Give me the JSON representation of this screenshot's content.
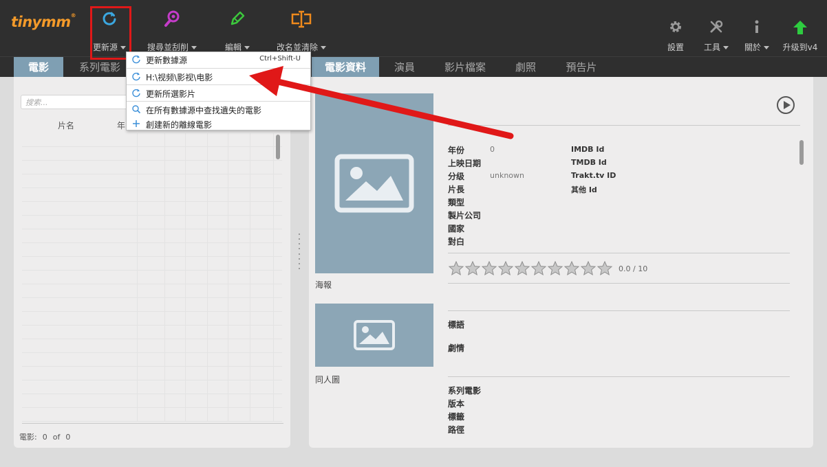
{
  "app": {
    "logo": "tinymm",
    "logo_mark": "®"
  },
  "toolbar": {
    "update_source": "更新源",
    "search_scrape": "搜尋並刮削",
    "edit": "編輯",
    "rename_clean": "改名並清除",
    "settings": "設置",
    "tools": "工具",
    "about": "關於",
    "upgrade": "升级到v4"
  },
  "left_tabs": {
    "movies": "電影",
    "series_movies": "系列電影"
  },
  "right_tabs": {
    "movie_info": "電影資料",
    "cast": "演員",
    "media_files": "影片檔案",
    "artwork": "劇照",
    "trailers": "預告片"
  },
  "movie_list": {
    "search_placeholder": "搜索...",
    "col_title": "片名",
    "col_year": "年",
    "footer_label": "電影:",
    "footer_count": "0",
    "footer_of": "of",
    "footer_total": "0"
  },
  "dropdown": {
    "items": [
      {
        "label": "更新數據源",
        "shortcut": "Ctrl+Shift-U",
        "icon": "refresh-icon"
      },
      {
        "label": "H:\\视频\\影视\\电影",
        "icon": "refresh-icon"
      },
      {
        "label": "更新所選影片",
        "icon": "refresh-icon"
      },
      {
        "label": "在所有數據源中查找遺失的電影",
        "icon": "search-icon"
      },
      {
        "label": "創建新的離線電影",
        "icon": "plus-icon"
      }
    ]
  },
  "details": {
    "poster_caption": "海報",
    "fanart_caption": "同人圖",
    "year_label": "年份",
    "year_value": "0",
    "release_label": "上映日期",
    "cert_label": "分级",
    "cert_value": "unknown",
    "runtime_label": "片長",
    "genre_label": "類型",
    "studio_label": "製片公司",
    "country_label": "國家",
    "dialog_label": "對白",
    "imdb_label": "IMDB Id",
    "tmdb_label": "TMDB Id",
    "trakt_label": "Trakt.tv ID",
    "other_label": "其他 Id",
    "rating_text": "0.0 / 10",
    "rating_value": 0,
    "tagline_label": "標語",
    "plot_label": "劇情",
    "collection_label": "系列電影",
    "edition_label": "版本",
    "tags_label": "標籤",
    "path_label": "路徑"
  },
  "colors": {
    "toolbar_bg": "#2f2f2f",
    "accent_tab": "#7f9fb3",
    "refresh": "#3ba7e0",
    "search": "#c53cc9",
    "edit": "#3cc83c",
    "rename": "#f08a1c",
    "upgrade": "#2ecc40",
    "annotation": "#e01818"
  }
}
